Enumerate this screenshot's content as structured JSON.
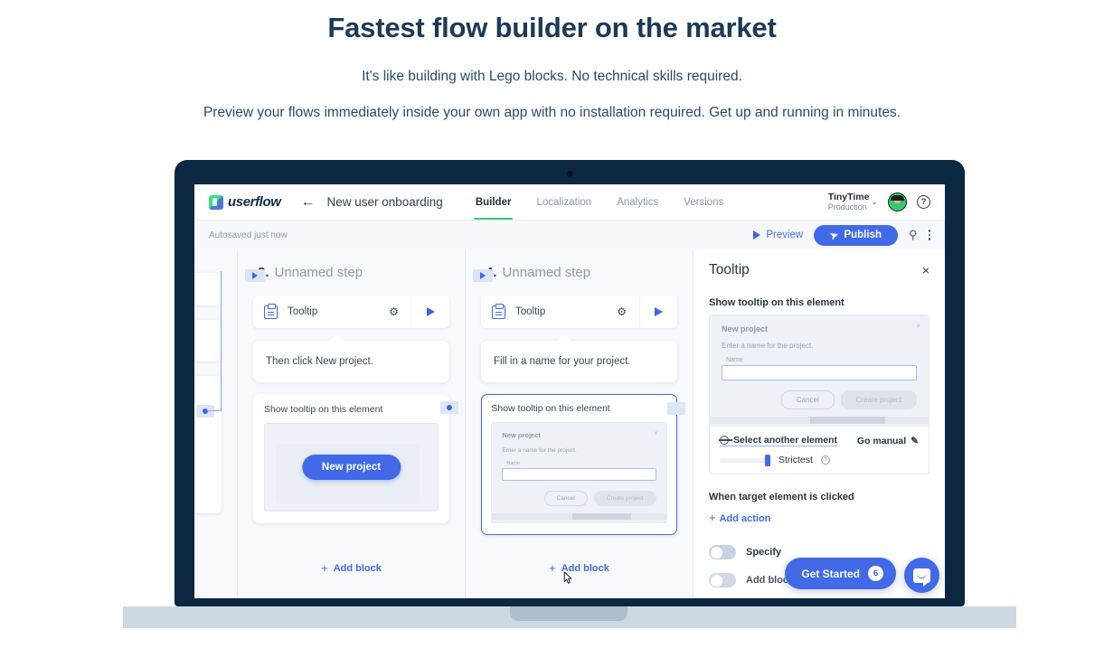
{
  "hero": {
    "title": "Fastest flow builder on the market",
    "subtitle1": "It's like building with Lego blocks. No technical skills required.",
    "subtitle2": "Preview your flows immediately inside your own app with no installation required. Get up and running in minutes."
  },
  "app": {
    "logo_text": "userflow",
    "back_label": "←",
    "flow_title": "New user onboarding",
    "nav": [
      {
        "label": "Builder",
        "active": true
      },
      {
        "label": "Localization",
        "active": false
      },
      {
        "label": "Analytics",
        "active": false
      },
      {
        "label": "Versions",
        "active": false
      }
    ],
    "tenant": {
      "name": "TinyTime",
      "env": "Production",
      "chevron": "⌄"
    },
    "help_glyph": "?"
  },
  "toolbar": {
    "autosaved": "Autosaved just now",
    "preview_label": "Preview",
    "publish_label": "Publish",
    "publish_icon": "➤",
    "bulb_icon": "⚲"
  },
  "canvas": {
    "steps": [
      {
        "number": "3.",
        "name": "Unnamed step",
        "block_label": "Tooltip",
        "gear_icon": "⚙",
        "speech_text": "Then click New project.",
        "element_title": "Show tooltip on this element",
        "mock_type": "button",
        "mock_button_label": "New project",
        "selected": false,
        "add_block_label": "Add block"
      },
      {
        "number": "4.",
        "name": "Unnamed step",
        "block_label": "Tooltip",
        "gear_icon": "⚙",
        "speech_text": "Fill in a name for your project.",
        "element_title": "Show tooltip on this element",
        "mock_type": "modal",
        "selected": true,
        "add_block_label": "Add block"
      }
    ],
    "modal_mock": {
      "title": "New project",
      "close": "×",
      "description": "Enter a name for the project.",
      "field_label": "Name",
      "field_value": "",
      "cancel_label": "Cancel",
      "primary_label": "Create project"
    }
  },
  "panel": {
    "title": "Tooltip",
    "close": "×",
    "show_tooltip_label": "Show tooltip on this element",
    "modal_preview": {
      "title": "New project",
      "close": "×",
      "description": "Enter a name for the project.",
      "field_label": "Name",
      "field_value": "",
      "cancel_label": "Cancel",
      "primary_label": "Create project"
    },
    "select_element_label": "Select another element",
    "go_manual_label": "Go manual",
    "go_manual_icon": "✎",
    "strictness_label": "Strictest",
    "strictness_help": "?",
    "strictness_value": 100,
    "when_clicked_label": "When target element is clicked",
    "add_action_label": "Add action",
    "toggles": [
      {
        "label": "Specify",
        "on": false
      },
      {
        "label": "Add block label",
        "on": false
      }
    ]
  },
  "widgets": {
    "get_started_label": "Get Started",
    "get_started_count": "6",
    "chat_icon": "chat-bubble-icon"
  },
  "colors": {
    "brand_blue": "#4169e8",
    "brand_green": "#2ecc71",
    "device_navy": "#0b2840",
    "heading_navy": "#1b3a57",
    "device_base": "#ccd9e3"
  }
}
